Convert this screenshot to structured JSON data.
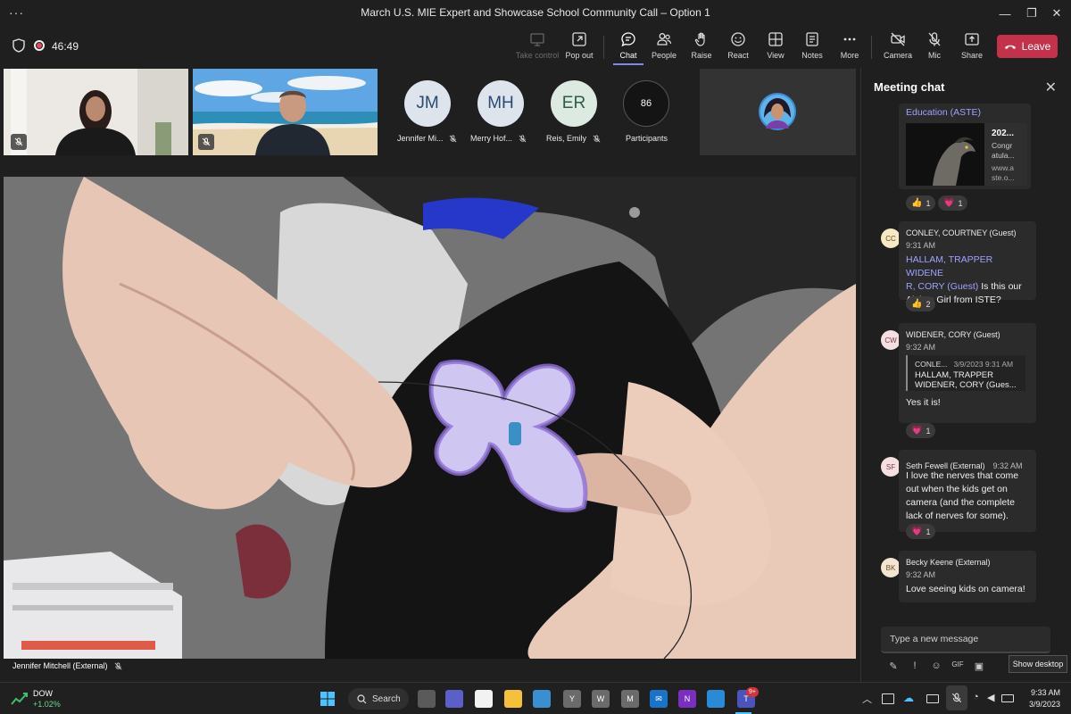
{
  "window": {
    "title": "March U.S. MIE Expert and Showcase School Community Call – Option 1",
    "menu_glyph": "···",
    "minimize_glyph": "—",
    "maximize_glyph": "❐",
    "close_glyph": "✕"
  },
  "toolbar": {
    "timer": "46:49",
    "take_control": "Take control",
    "pop_out": "Pop out",
    "chat": "Chat",
    "people": "People",
    "raise": "Raise",
    "react": "React",
    "view": "View",
    "notes": "Notes",
    "more": "More",
    "camera": "Camera",
    "mic": "Mic",
    "share": "Share",
    "leave": "Leave"
  },
  "participants": {
    "tiles": [
      {
        "initials": "JM",
        "name": "Jennifer Mi..."
      },
      {
        "initials": "MH",
        "name": "Merry Hof..."
      },
      {
        "initials": "ER",
        "name": "Reis, Emily"
      }
    ],
    "count": "86",
    "count_label": "Participants"
  },
  "stage": {
    "speaker": "Jennifer Mitchell (External)"
  },
  "chat": {
    "header": "Meeting chat",
    "messages": [
      {
        "link_text": "Education (ASTE)",
        "card_title": "202...",
        "card_text_1": "Congr",
        "card_text_2": "atula...",
        "card_text_3": "www.a",
        "card_text_4": "ste.o...",
        "reactions": [
          {
            "emoji": "👍",
            "count": "1"
          },
          {
            "emoji": "💗",
            "count": "1"
          }
        ]
      },
      {
        "initials": "CC",
        "name": "CONLEY, COURTNEY (Guest)",
        "time": "9:31 AM",
        "mention_1": "HALLAM, TRAPPER WIDENE",
        "mention_2": "R, CORY (Guest)",
        "text_1": " Is this our",
        "text_2": "Alaksa Girl from ISTE?",
        "reactions": [
          {
            "emoji": "👍",
            "count": "2"
          }
        ]
      },
      {
        "initials": "CW",
        "name": "WIDENER, CORY (Guest)",
        "time": "9:32 AM",
        "quote_author": "CONLE...",
        "quote_time": "3/9/2023 9:31 AM",
        "quote_text_1": "HALLAM, TRAPPER",
        "quote_text_2": "WIDENER, CORY (Gues...",
        "text": "Yes it is!",
        "reactions": [
          {
            "emoji": "💗",
            "count": "1"
          }
        ]
      },
      {
        "initials": "SF",
        "name": "Seth Fewell (External)",
        "time": "9:32 AM",
        "text_1": "I love the nerves that come",
        "text_2": "out when the kids get on",
        "text_3": "camera (and the complete",
        "text_4": "lack of nerves for some).",
        "reactions": [
          {
            "emoji": "💗",
            "count": "1"
          }
        ]
      },
      {
        "initials": "BK",
        "name": "Becky Keene (External)",
        "time": "9:32 AM",
        "text": "Love seeing kids on camera!"
      }
    ],
    "compose_placeholder": "Type a new message",
    "show_desktop": "Show desktop"
  },
  "taskbar": {
    "weather_title": "DOW",
    "weather_value": "+1.02%",
    "search": "Search",
    "teams_badge": "9+",
    "time": "9:33 AM",
    "date": "3/9/2023"
  },
  "colors": {
    "accent": "#7f85f5",
    "leave": "#c4314b",
    "recording": "#e84a5f"
  }
}
